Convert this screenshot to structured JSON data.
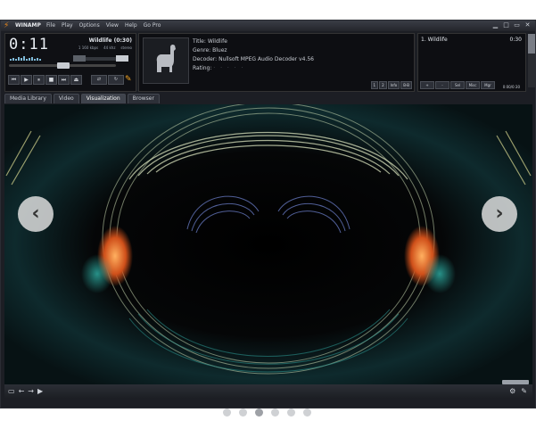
{
  "titlebar": {
    "app_name": "WINAMP",
    "menu": [
      "File",
      "Play",
      "Options",
      "View",
      "Help",
      "Go Pro"
    ],
    "window_controls": [
      "minimize-icon",
      "maximize-icon",
      "restore-icon",
      "close-icon"
    ]
  },
  "player": {
    "time": "0:11",
    "track_title": "Wildlife (0:30)",
    "kbps": "1 160 kbps",
    "khz": "44 khz",
    "channels": "stereo",
    "controls": [
      "previous-icon",
      "play-icon",
      "pause-icon",
      "stop-icon",
      "next-icon",
      "eject-icon"
    ],
    "extra_buttons": [
      "shuffle",
      "repeat"
    ]
  },
  "info": {
    "title_label": "Title:",
    "title_value": "Wildlife",
    "genre_label": "Genre:",
    "genre_value": "Bluez",
    "decoder_label": "Decoder:",
    "decoder_value": "Nullsoft MPEG Audio Decoder v4.56",
    "rating_label": "Rating:",
    "rating_stars": "· · · · ·",
    "buttons": [
      "1",
      "2",
      "Info",
      "B-B"
    ]
  },
  "playlist": {
    "items": [
      {
        "label": "1. Wildlife",
        "duration": "0:30"
      }
    ],
    "buttons": [
      "+",
      "-",
      "Sel",
      "Misc",
      "Mgr"
    ],
    "time": "0:00/0:30"
  },
  "tabs": [
    {
      "label": "Media Library",
      "active": false
    },
    {
      "label": "Video",
      "active": false
    },
    {
      "label": "Visualization",
      "active": true
    },
    {
      "label": "Browser",
      "active": false
    }
  ],
  "bottombar": {
    "left_icons": [
      "screen-icon",
      "back-icon",
      "forward-icon",
      "options-icon"
    ],
    "right_icons": [
      "settings-icon",
      "tools-icon"
    ]
  },
  "carousel": {
    "prev_label": "‹",
    "next_label": "›",
    "dots": 6,
    "active_dot": 2
  },
  "colors": {
    "accent": "#f08a1a",
    "background": "#1c1e24"
  }
}
